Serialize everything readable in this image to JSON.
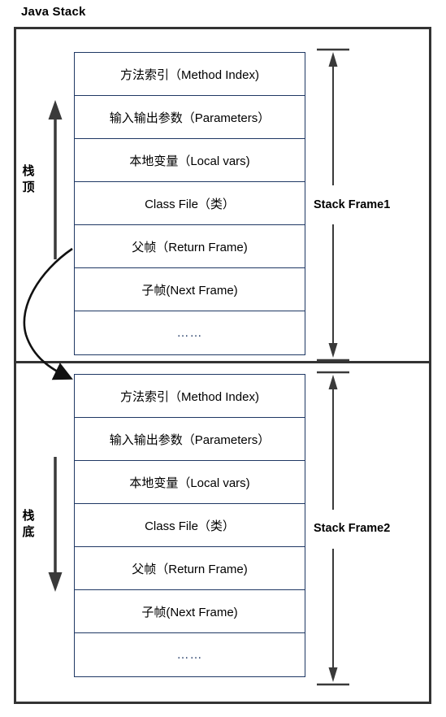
{
  "diagram": {
    "title": "Java Stack",
    "colors": {
      "outer_border": "#333333",
      "cell_border": "#1f3864",
      "arrow": "#333333",
      "text": "#000000",
      "background": "#ffffff"
    }
  },
  "slot_labels": {
    "method_index": "方法索引（Method Index)",
    "parameters": "输入输出参数（Parameters）",
    "local_vars": "本地变量（Local vars)",
    "class_file": "Class File（类）",
    "return_frame": "父帧（Return Frame)",
    "next_frame": "子帧(Next Frame)",
    "ellipsis": "……"
  },
  "frames": [
    {
      "measure_label": "Stack Frame1",
      "direction_label": "栈顶",
      "direction": "up",
      "rows": [
        "方法索引（Method Index)",
        "输入输出参数（Parameters）",
        "本地变量（Local vars)",
        "Class File（类）",
        "父帧（Return Frame)",
        "子帧(Next Frame)",
        "……"
      ]
    },
    {
      "measure_label": "Stack Frame2",
      "direction_label": "栈底",
      "direction": "down",
      "rows": [
        "方法索引（Method Index)",
        "输入输出参数（Parameters）",
        "本地变量（Local vars)",
        "Class File（类）",
        "父帧（Return Frame)",
        "子帧(Next Frame)",
        "……"
      ]
    }
  ],
  "connector": {
    "name": "return-frame-to-next-stack-frame",
    "from": "父帧（Return Frame)",
    "to": "方法索引（Method Index)"
  }
}
